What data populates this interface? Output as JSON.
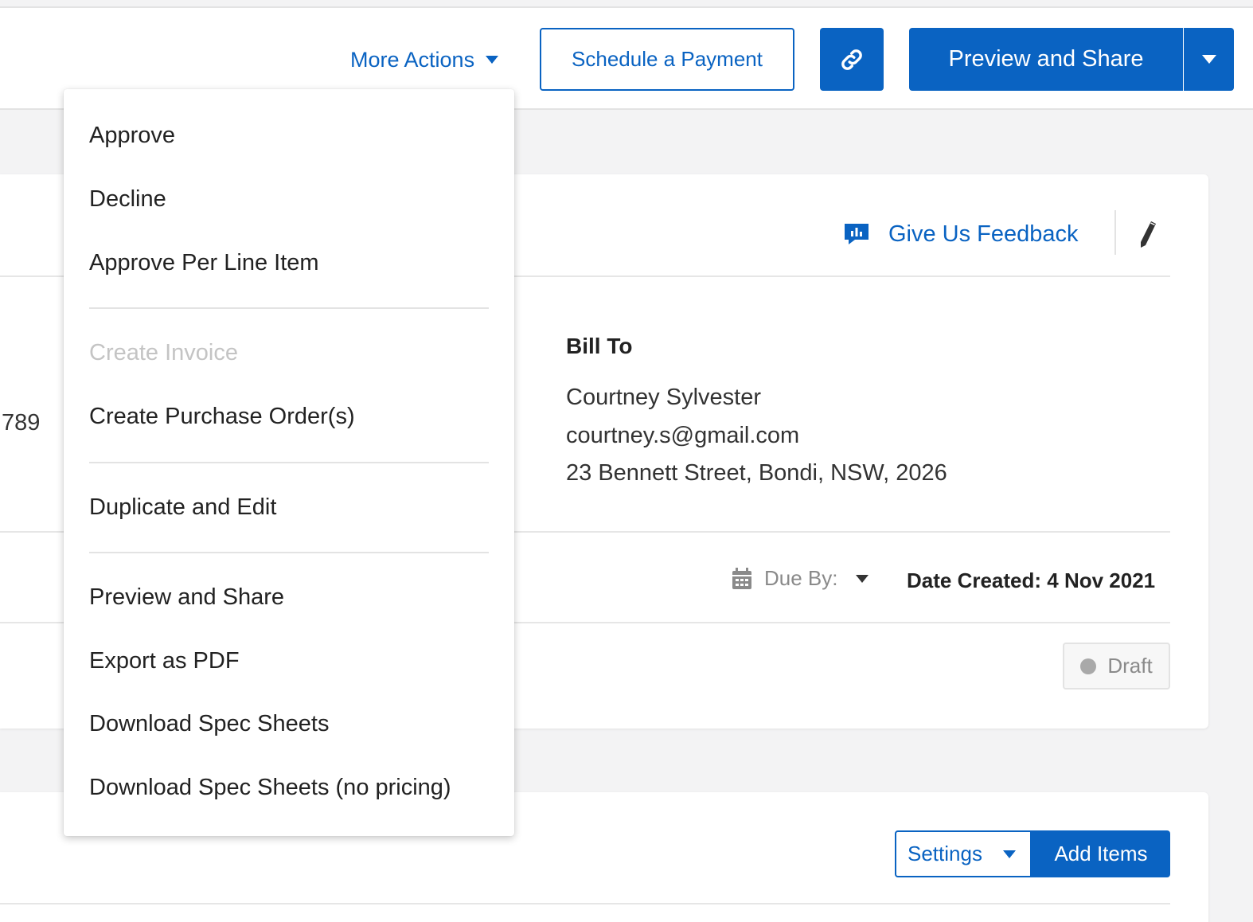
{
  "toolbar": {
    "more_actions_label": "More Actions",
    "schedule_payment_label": "Schedule a Payment",
    "preview_share_label": "Preview and Share"
  },
  "menu": {
    "items": [
      {
        "label": "Approve",
        "enabled": true
      },
      {
        "label": "Decline",
        "enabled": true
      },
      {
        "label": "Approve Per Line Item",
        "enabled": true
      },
      {
        "label": "Create Invoice",
        "enabled": false
      },
      {
        "label": "Create Purchase Order(s)",
        "enabled": true
      },
      {
        "label": "Duplicate and Edit",
        "enabled": true
      },
      {
        "label": "Preview and Share",
        "enabled": true
      },
      {
        "label": "Export as PDF",
        "enabled": true
      },
      {
        "label": "Download Spec Sheets",
        "enabled": true
      },
      {
        "label": "Download Spec Sheets (no pricing)",
        "enabled": true
      }
    ]
  },
  "card": {
    "feedback_label": "Give Us Feedback",
    "partial_number": "789",
    "bill_to": {
      "heading": "Bill To",
      "name": "Courtney Sylvester",
      "email": "courtney.s@gmail.com",
      "address": "23 Bennett Street, Bondi, NSW, 2026"
    },
    "due_by_label": "Due By:",
    "date_created": "Date Created: 4 Nov 2021",
    "status": "Draft"
  },
  "items_card": {
    "settings_label": "Settings",
    "add_items_label": "Add Items"
  },
  "colors": {
    "accent": "#0a63c2",
    "muted": "#8a8a8a",
    "disabled": "#c4c4c4"
  }
}
